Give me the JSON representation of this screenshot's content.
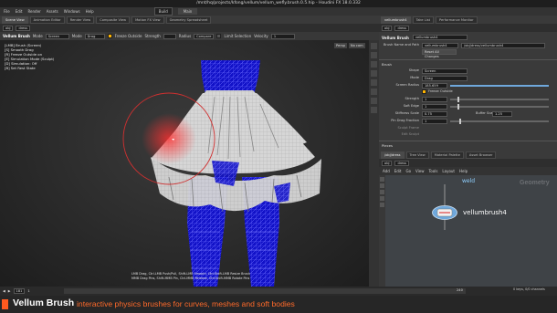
{
  "window": {
    "title": "/mnt/hq/projects/kfong/vellum/vellum_wefly.brush.0.5.hip - Houdini FX 18.0.332"
  },
  "menubar": {
    "items": [
      "File",
      "Edit",
      "Render",
      "Assets",
      "Windows",
      "Help"
    ],
    "build": "Build",
    "desktop": "Main"
  },
  "viewport_tabs": [
    "Scene View",
    "Animation Editor",
    "Render View",
    "Composite View",
    "Motion FX View",
    "Geometry Spreadsheet"
  ],
  "viewport_path": {
    "obj": "obj",
    "node": "dress"
  },
  "tool_options": {
    "tool": "Vellum Brush",
    "mode_label": "Mode",
    "mode_value": "Screen",
    "drag_label": "Mode",
    "drag_value": "Drag",
    "freeze_label": "Freeze Outside",
    "strength_label": "Strength",
    "radius_label": "Radius",
    "compare_value": "Compare",
    "limit_label": "Limit Selection",
    "velocity_label": "Velocity",
    "velocity_value": "1"
  },
  "hud": [
    "[LMB] Brush (Screen)",
    "[S] Smooth Drag",
    "[R] Freeze Outside on",
    "[E] Simulation Mode (Sculpt)",
    "[D] Simulation: Off",
    "[B] Set Rest State"
  ],
  "view_controls": {
    "persp": "Persp",
    "cam": "No cam"
  },
  "hotkeys": [
    "LMB Drag, Ctrl-LMB Push/Pull, Shift-LMB Smooth, Ctrl-Shift-LMB Resize Brush",
    "MMB Drag Pins, Shift-MMB Pin, Ctrl-MMB Release, Ctrl-Shift-MMB Rotate Pins"
  ],
  "timeline": {
    "frame": "181",
    "start": "1",
    "end": "240",
    "mid": "1251",
    "realtime": "Auto Update",
    "keys": "0 keys, 0/0 channels"
  },
  "banner": {
    "title": "Vellum Brush",
    "subtitle": "interactive physics brushes for curves, meshes and soft bodies"
  },
  "right_tabs": [
    "vellumbrush4",
    "Take List",
    "Performance Monitor"
  ],
  "right_path": {
    "obj": "obj",
    "node": "dress"
  },
  "params": {
    "header": "Vellum Brush",
    "node_name": "vellumbrush4",
    "brush_label": "Brush Name and Path",
    "brush_value": "vellumbrush4",
    "path_value": "/obj/dress/vellumbrush4",
    "reset_label": "Reset All Changes",
    "section_brush": "Brush",
    "shape_label": "Shape",
    "shape_value": "Screen",
    "mode_label": "Mode",
    "mode_value": "Drag",
    "radius_label": "Screen Radius",
    "radius_value": "185.659",
    "freeze_label": "Freeze Outside",
    "strength_label": "Strength",
    "strength_value": "1",
    "softedge_label": "Soft Edge",
    "softedge_value": "1",
    "stiffness_label": "Stiffness Scale",
    "stiffness_value": "0.75",
    "damp_label": "Buffer Scale",
    "damp_value": "1.25",
    "pin_label": "Pin Drag Fraction",
    "pin_value": "1",
    "sculpt_label": "Sculpt Frame",
    "sculpt2_label": "Edit Sculpt",
    "section_pieces": "Pieces"
  },
  "network_tabs": [
    "/obj/dress",
    "Tree View",
    "Material Palette",
    "Asset Browser"
  ],
  "network_path": {
    "obj": "obj",
    "node": "dress"
  },
  "network_menu": [
    "Add",
    "Edit",
    "Go",
    "View",
    "Tools",
    "Layout",
    "Help"
  ],
  "network": {
    "context_label": "Geometry",
    "upstream_label": "weld",
    "node_label": "vellumbrush4"
  },
  "colors": {
    "accent": "#ff5a1f",
    "node": "#6fa8dc",
    "skirt": "#d0d0d0",
    "stockings": "#1b1bd6"
  }
}
